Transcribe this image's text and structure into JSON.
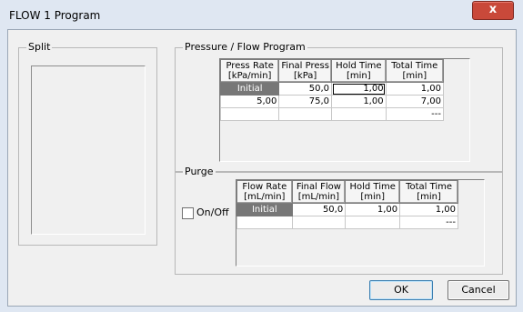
{
  "window": {
    "title": "FLOW 1 Program",
    "close_glyph": "x",
    "close_icon": "close-icon"
  },
  "split": {
    "label": "Split"
  },
  "pressure": {
    "label": "Pressure / Flow Program",
    "columns": [
      "Press Rate\n[kPa/min]",
      "Final Press\n[kPa]",
      "Hold Time\n[min]",
      "Total Time\n[min]"
    ],
    "rows": [
      [
        "Initial",
        "50,0",
        "1,00",
        "1,00"
      ],
      [
        "5,00",
        "75,0",
        "1,00",
        "7,00"
      ],
      [
        "",
        "",
        "",
        "---"
      ]
    ]
  },
  "purge": {
    "label": "Purge",
    "checkbox_label": "On/Off",
    "checked": false,
    "columns": [
      "Flow Rate\n[mL/min]",
      "Final Flow\n[mL/min]",
      "Hold Time\n[min]",
      "Total Time\n[min]"
    ],
    "rows": [
      [
        "Initial",
        "50,0",
        "1,00",
        "1,00"
      ],
      [
        "",
        "",
        "",
        "---"
      ]
    ]
  },
  "buttons": {
    "ok": "OK",
    "cancel": "Cancel"
  }
}
